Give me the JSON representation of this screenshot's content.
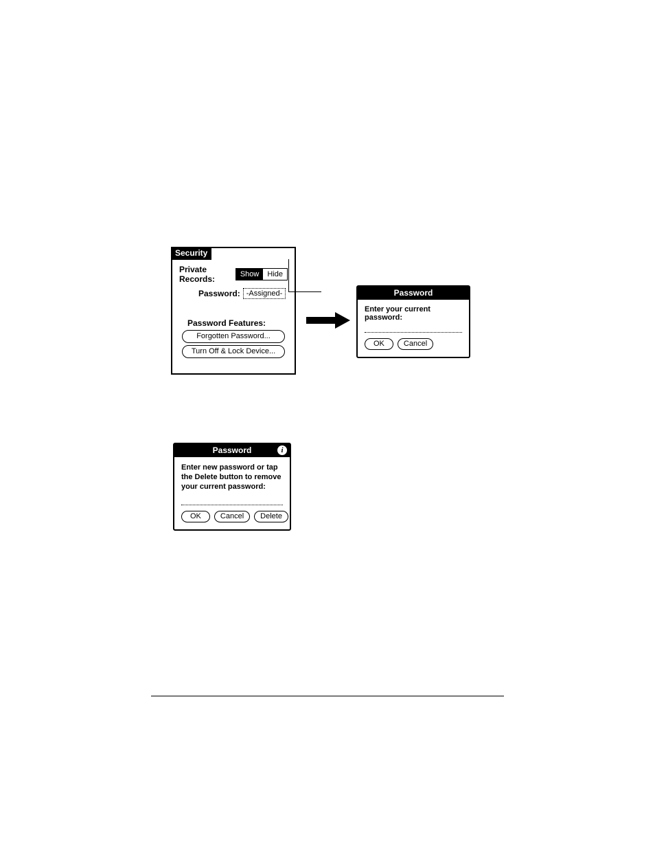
{
  "security": {
    "title": "Security",
    "private_records_label": "Private Records:",
    "show_label": "Show",
    "hide_label": "Hide",
    "password_label": "Password:",
    "password_value": "-Assigned-",
    "features_heading": "Password Features:",
    "forgotten_btn": "Forgotten Password...",
    "lock_btn": "Turn Off & Lock Device..."
  },
  "pwd_current": {
    "title": "Password",
    "prompt": "Enter your current password:",
    "ok": "OK",
    "cancel": "Cancel"
  },
  "pwd_new": {
    "title": "Password",
    "prompt": "Enter new password or tap the Delete button to remove your current password:",
    "ok": "OK",
    "cancel": "Cancel",
    "delete": "Delete",
    "info_glyph": "i"
  }
}
